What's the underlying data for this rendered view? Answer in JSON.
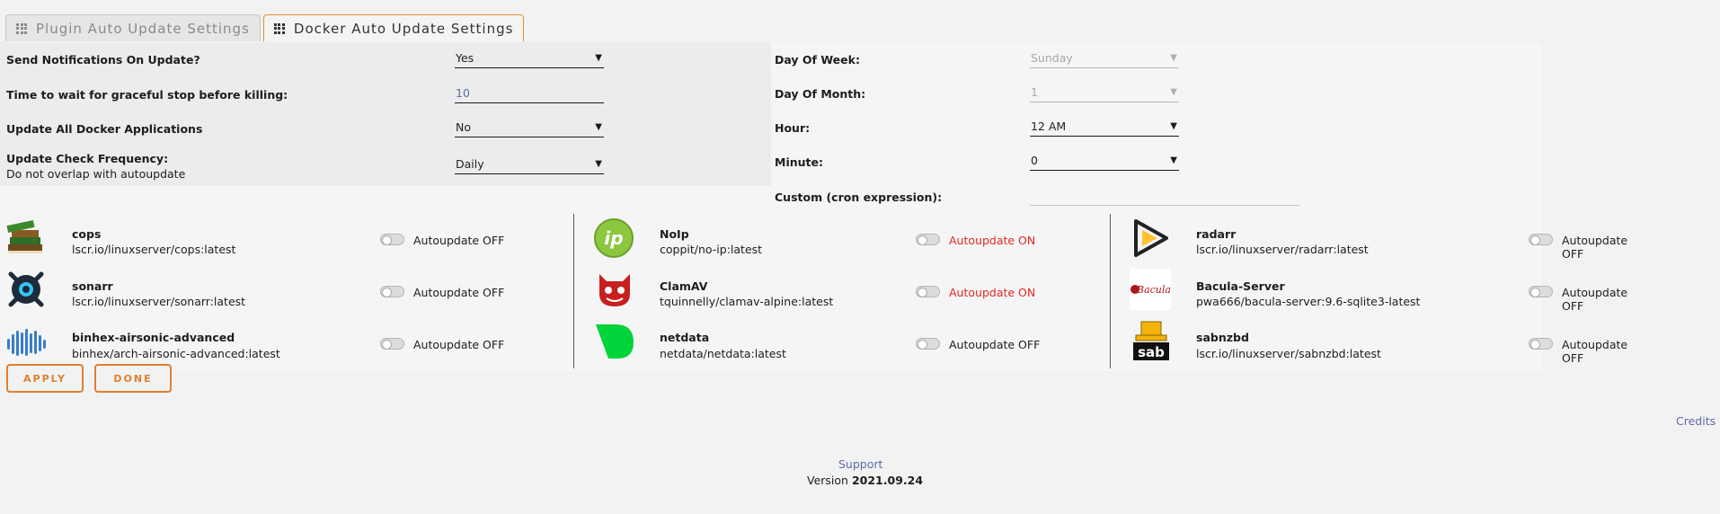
{
  "tabs": [
    {
      "label": "Plugin Auto Update Settings",
      "active": false
    },
    {
      "label": "Docker Auto Update Settings",
      "active": true
    }
  ],
  "settings": {
    "notify_label": "Send Notifications On Update?",
    "notify_value": "Yes",
    "wait_label": "Time to wait for graceful stop before killing:",
    "wait_value": "10",
    "update_all_label": "Update All Docker Applications",
    "update_all_value": "No",
    "frequency_label": "Update Check Frequency:",
    "frequency_sub": "Do not overlap with autoupdate",
    "frequency_value": "Daily",
    "day_of_week_label": "Day Of Week:",
    "day_of_week_value": "Sunday",
    "day_of_month_label": "Day Of Month:",
    "day_of_month_value": "1",
    "hour_label": "Hour:",
    "hour_value": "12 AM",
    "minute_label": "Minute:",
    "minute_value": "0",
    "cron_label": "Custom (cron expression):",
    "cron_value": ""
  },
  "apps": [
    {
      "name": "cops",
      "repo": "lscr.io/linuxserver/cops:latest",
      "status": "Autoupdate OFF",
      "icon": "books-icon"
    },
    {
      "name": "sonarr",
      "repo": "lscr.io/linuxserver/sonarr:latest",
      "status": "Autoupdate OFF",
      "icon": "sonarr-icon"
    },
    {
      "name": "binhex-airsonic-advanced",
      "repo": "binhex/arch-airsonic-advanced:latest",
      "status": "Autoupdate OFF",
      "icon": "airsonic-icon"
    },
    {
      "name": "NoIp",
      "repo": "coppit/no-ip:latest",
      "status": "Autoupdate ON",
      "icon": "noip-icon"
    },
    {
      "name": "ClamAV",
      "repo": "tquinnelly/clamav-alpine:latest",
      "status": "Autoupdate ON",
      "icon": "clamav-icon"
    },
    {
      "name": "netdata",
      "repo": "netdata/netdata:latest",
      "status": "Autoupdate OFF",
      "icon": "netdata-icon"
    },
    {
      "name": "radarr",
      "repo": "lscr.io/linuxserver/radarr:latest",
      "status": "Autoupdate OFF",
      "icon": "radarr-icon"
    },
    {
      "name": "Bacula-Server",
      "repo": "pwa666/bacula-server:9.6-sqlite3-latest",
      "status": "Autoupdate OFF",
      "icon": "bacula-icon",
      "icon_text": "Bacula"
    },
    {
      "name": "sabnzbd",
      "repo": "lscr.io/linuxserver/sabnzbd:latest",
      "status": "Autoupdate OFF",
      "icon": "sabnzbd-icon",
      "icon_text": "sab"
    }
  ],
  "buttons": {
    "apply": "APPLY",
    "done": "DONE"
  },
  "footer": {
    "credits": "Credits",
    "support": "Support",
    "version_prefix": "Version",
    "version": "2021.09.24"
  },
  "colors": {
    "accent": "#e07f2f",
    "link": "#5c6ba8",
    "on": "#e22828",
    "background": "#f2f2f2"
  }
}
